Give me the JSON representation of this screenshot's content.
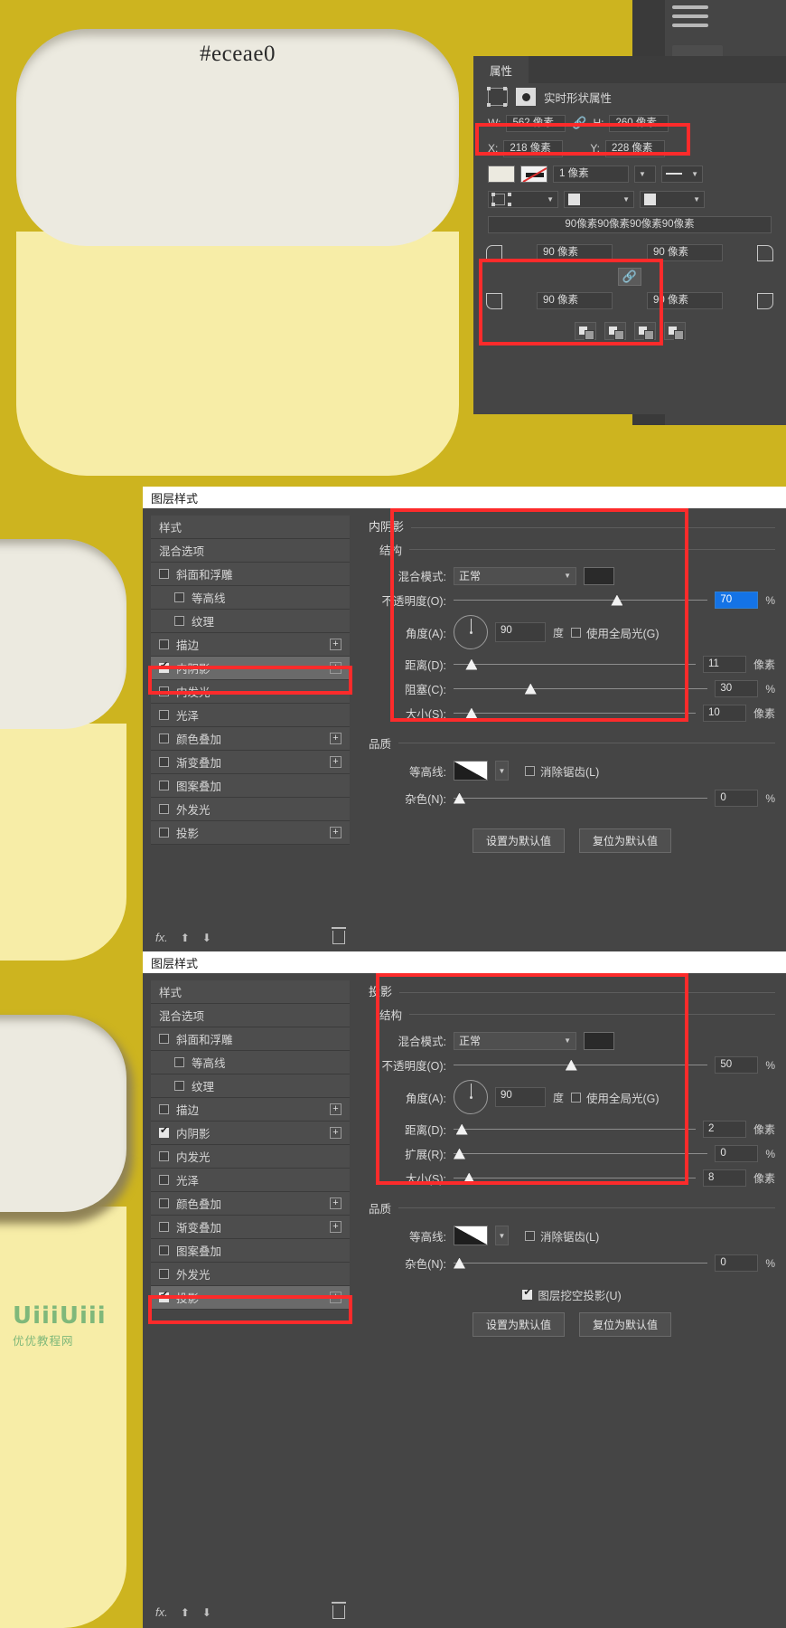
{
  "canvas": {
    "hex_label": "#eceae0",
    "bg_color": "#cdb41f",
    "card_white": "#eceae0",
    "card_yellow": "#f7eda7"
  },
  "properties_panel": {
    "tab_label": "属性",
    "header_label": "实时形状属性",
    "width_label": "W:",
    "width_value": "562 像素",
    "height_label": "H:",
    "height_value": "260 像素",
    "x_label": "X:",
    "x_value": "218 像素",
    "y_label": "Y:",
    "y_value": "228 像素",
    "stroke_width": "1 像素",
    "radii_readout": "90像素90像素90像素90像素",
    "radius_tl": "90 像素",
    "radius_tr": "90 像素",
    "radius_bl": "90 像素",
    "radius_br": "90 像素"
  },
  "inner_shadow_dialog": {
    "title": "图层样式",
    "sidebar": [
      {
        "label": "样式",
        "checkbox": false,
        "checked": false,
        "sub": false,
        "plus": false,
        "selected": false
      },
      {
        "label": "混合选项",
        "checkbox": false,
        "checked": false,
        "sub": false,
        "plus": false,
        "selected": false
      },
      {
        "label": "斜面和浮雕",
        "checkbox": true,
        "checked": false,
        "sub": false,
        "plus": false,
        "selected": false
      },
      {
        "label": "等高线",
        "checkbox": true,
        "checked": false,
        "sub": true,
        "plus": false,
        "selected": false
      },
      {
        "label": "纹理",
        "checkbox": true,
        "checked": false,
        "sub": true,
        "plus": false,
        "selected": false
      },
      {
        "label": "描边",
        "checkbox": true,
        "checked": false,
        "sub": false,
        "plus": true,
        "selected": false
      },
      {
        "label": "内阴影",
        "checkbox": true,
        "checked": true,
        "sub": false,
        "plus": true,
        "selected": true
      },
      {
        "label": "内发光",
        "checkbox": true,
        "checked": false,
        "sub": false,
        "plus": false,
        "selected": false
      },
      {
        "label": "光泽",
        "checkbox": true,
        "checked": false,
        "sub": false,
        "plus": false,
        "selected": false
      },
      {
        "label": "颜色叠加",
        "checkbox": true,
        "checked": false,
        "sub": false,
        "plus": true,
        "selected": false
      },
      {
        "label": "渐变叠加",
        "checkbox": true,
        "checked": false,
        "sub": false,
        "plus": true,
        "selected": false
      },
      {
        "label": "图案叠加",
        "checkbox": true,
        "checked": false,
        "sub": false,
        "plus": false,
        "selected": false
      },
      {
        "label": "外发光",
        "checkbox": true,
        "checked": false,
        "sub": false,
        "plus": false,
        "selected": false
      },
      {
        "label": "投影",
        "checkbox": true,
        "checked": false,
        "sub": false,
        "plus": true,
        "selected": false
      }
    ],
    "fx_label": "fx.",
    "section_title": "内阴影",
    "structure_title": "结构",
    "blend_mode_label": "混合模式:",
    "blend_mode_value": "正常",
    "blend_color": "#3b3b3b",
    "opacity_label": "不透明度(O):",
    "opacity_value": "70",
    "opacity_unit": "%",
    "angle_label": "角度(A):",
    "angle_value": "90",
    "angle_unit": "度",
    "global_light_label": "使用全局光(G)",
    "distance_label": "距离(D):",
    "distance_value": "11",
    "distance_unit": "像素",
    "choke_label": "阻塞(C):",
    "choke_value": "30",
    "choke_unit": "%",
    "size_label": "大小(S):",
    "size_value": "10",
    "size_unit": "像素",
    "quality_title": "品质",
    "contour_label": "等高线:",
    "antialias_label": "消除锯齿(L)",
    "noise_label": "杂色(N):",
    "noise_value": "0",
    "noise_unit": "%",
    "make_default_btn": "设置为默认值",
    "reset_default_btn": "复位为默认值"
  },
  "drop_shadow_dialog": {
    "title": "图层样式",
    "sidebar": [
      {
        "label": "样式",
        "checkbox": false,
        "checked": false,
        "sub": false,
        "plus": false,
        "selected": false
      },
      {
        "label": "混合选项",
        "checkbox": false,
        "checked": false,
        "sub": false,
        "plus": false,
        "selected": false
      },
      {
        "label": "斜面和浮雕",
        "checkbox": true,
        "checked": false,
        "sub": false,
        "plus": false,
        "selected": false
      },
      {
        "label": "等高线",
        "checkbox": true,
        "checked": false,
        "sub": true,
        "plus": false,
        "selected": false
      },
      {
        "label": "纹理",
        "checkbox": true,
        "checked": false,
        "sub": true,
        "plus": false,
        "selected": false
      },
      {
        "label": "描边",
        "checkbox": true,
        "checked": false,
        "sub": false,
        "plus": true,
        "selected": false
      },
      {
        "label": "内阴影",
        "checkbox": true,
        "checked": true,
        "sub": false,
        "plus": true,
        "selected": false
      },
      {
        "label": "内发光",
        "checkbox": true,
        "checked": false,
        "sub": false,
        "plus": false,
        "selected": false
      },
      {
        "label": "光泽",
        "checkbox": true,
        "checked": false,
        "sub": false,
        "plus": false,
        "selected": false
      },
      {
        "label": "颜色叠加",
        "checkbox": true,
        "checked": false,
        "sub": false,
        "plus": true,
        "selected": false
      },
      {
        "label": "渐变叠加",
        "checkbox": true,
        "checked": false,
        "sub": false,
        "plus": true,
        "selected": false
      },
      {
        "label": "图案叠加",
        "checkbox": true,
        "checked": false,
        "sub": false,
        "plus": false,
        "selected": false
      },
      {
        "label": "外发光",
        "checkbox": true,
        "checked": false,
        "sub": false,
        "plus": false,
        "selected": false
      },
      {
        "label": "投影",
        "checkbox": true,
        "checked": true,
        "sub": false,
        "plus": true,
        "selected": true
      }
    ],
    "fx_label": "fx.",
    "section_title": "投影",
    "structure_title": "结构",
    "blend_mode_label": "混合模式:",
    "blend_mode_value": "正常",
    "blend_color": "#3b3b3b",
    "opacity_label": "不透明度(O):",
    "opacity_value": "50",
    "opacity_unit": "%",
    "angle_label": "角度(A):",
    "angle_value": "90",
    "angle_unit": "度",
    "global_light_label": "使用全局光(G)",
    "distance_label": "距离(D):",
    "distance_value": "2",
    "distance_unit": "像素",
    "spread_label": "扩展(R):",
    "spread_value": "0",
    "spread_unit": "%",
    "size_label": "大小(S):",
    "size_value": "8",
    "size_unit": "像素",
    "quality_title": "品质",
    "contour_label": "等高线:",
    "antialias_label": "消除锯齿(L)",
    "noise_label": "杂色(N):",
    "noise_value": "0",
    "noise_unit": "%",
    "knockout_label": "图层挖空投影(U)",
    "make_default_btn": "设置为默认值",
    "reset_default_btn": "复位为默认值"
  },
  "watermark": {
    "logo": "UiiiUiii",
    "site": "优优教程网",
    "color": "#7fb87a"
  },
  "accent": {
    "highlight_red": "#fc2b2b",
    "blue": "#1473e6"
  }
}
